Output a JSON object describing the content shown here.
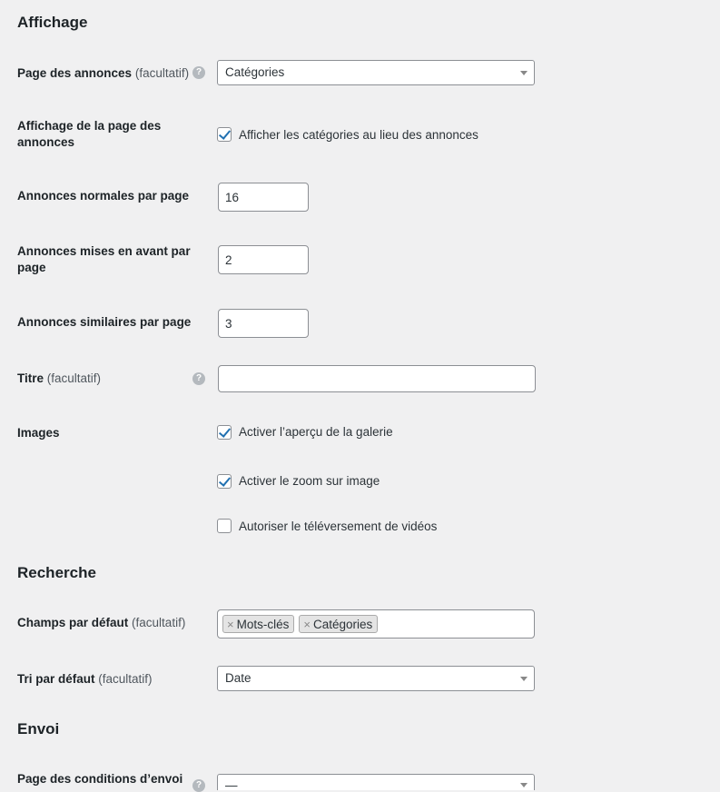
{
  "sections": {
    "display": "Affichage",
    "search": "Recherche",
    "submit": "Envoi"
  },
  "optional_suffix": "(facultatif)",
  "help_glyph": "?",
  "listings_page": {
    "label": "Page des annonces",
    "value": "Catégories"
  },
  "listings_display": {
    "label": "Affichage de la page des annonces",
    "checkbox_label": "Afficher les catégories au lieu des annonces",
    "checked": true
  },
  "normal_per_page": {
    "label": "Annonces normales par page",
    "value": "16"
  },
  "featured_per_page": {
    "label": "Annonces mises en avant par page",
    "value": "2"
  },
  "similar_per_page": {
    "label": "Annonces similaires par page",
    "value": "3"
  },
  "title_field": {
    "label": "Titre",
    "value": ""
  },
  "images": {
    "label": "Images",
    "gallery_preview": {
      "label": "Activer l’aperçu de la galerie",
      "checked": true
    },
    "image_zoom": {
      "label": "Activer le zoom sur image",
      "checked": true
    },
    "video_upload": {
      "label": "Autoriser le téléversement de vidéos",
      "checked": false
    }
  },
  "default_fields": {
    "label": "Champs par défaut",
    "tags": [
      "Mots-clés",
      "Catégories"
    ],
    "remove_glyph": "×"
  },
  "default_sort": {
    "label": "Tri par défaut",
    "value": "Date"
  },
  "terms_page": {
    "label": "Page des conditions d’envoi",
    "value": "—"
  }
}
